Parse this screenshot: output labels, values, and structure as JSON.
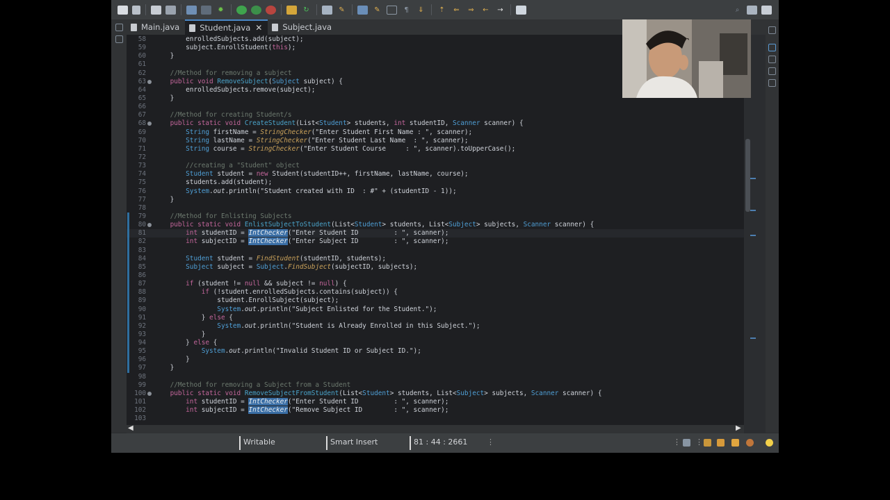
{
  "tabs": [
    {
      "label": "Main.java",
      "active": false
    },
    {
      "label": "Student.java",
      "active": true,
      "close": "✕"
    },
    {
      "label": "Subject.java",
      "active": false
    }
  ],
  "status": {
    "writable": "Writable",
    "insert_mode": "Smart Insert",
    "position": "81 : 44 : 2661"
  },
  "scroll_arrows": {
    "left": "◀",
    "right": "▶"
  },
  "code_lines": [
    {
      "n": "58",
      "segs": [
        [
          "p",
          "        enrolledSubjects.add(subject);"
        ]
      ]
    },
    {
      "n": "59",
      "segs": [
        [
          "p",
          "        subject.EnrollStudent("
        ],
        [
          "kw",
          "this"
        ],
        [
          "p",
          ");"
        ]
      ]
    },
    {
      "n": "60",
      "segs": [
        [
          "p",
          "    }"
        ]
      ]
    },
    {
      "n": "61",
      "segs": []
    },
    {
      "n": "62",
      "segs": [
        [
          "cm",
          "    //Method for removing a subject"
        ]
      ]
    },
    {
      "n": "63",
      "ovr": true,
      "segs": [
        [
          "kw",
          "    public void "
        ],
        [
          "fn",
          "RemoveSubject"
        ],
        [
          "p",
          "("
        ],
        [
          "ty",
          "Subject"
        ],
        [
          "p",
          " subject) {"
        ]
      ]
    },
    {
      "n": "64",
      "segs": [
        [
          "p",
          "        enrolledSubjects.remove(subject);"
        ]
      ]
    },
    {
      "n": "65",
      "segs": [
        [
          "p",
          "    }"
        ]
      ]
    },
    {
      "n": "66",
      "segs": []
    },
    {
      "n": "67",
      "segs": [
        [
          "cm",
          "    //Method for creating Student/s"
        ]
      ]
    },
    {
      "n": "68",
      "ovr": true,
      "segs": [
        [
          "kw",
          "    public static void "
        ],
        [
          "fn",
          "CreateStudent"
        ],
        [
          "p",
          "(List<"
        ],
        [
          "ty",
          "Student"
        ],
        [
          "p",
          "> students, "
        ],
        [
          "kw",
          "int"
        ],
        [
          "p",
          " studentID, "
        ],
        [
          "ty",
          "Scanner"
        ],
        [
          "p",
          " scanner) {"
        ]
      ]
    },
    {
      "n": "69",
      "segs": [
        [
          "ty",
          "        String"
        ],
        [
          "p",
          " firstName = "
        ],
        [
          "mth",
          "StringChecker"
        ],
        [
          "p",
          "(\"Enter Student First Name : \", scanner);"
        ]
      ]
    },
    {
      "n": "70",
      "segs": [
        [
          "ty",
          "        String"
        ],
        [
          "p",
          " lastName = "
        ],
        [
          "mth",
          "StringChecker"
        ],
        [
          "p",
          "(\"Enter Student Last Name  : \", scanner);"
        ]
      ]
    },
    {
      "n": "71",
      "segs": [
        [
          "ty",
          "        String"
        ],
        [
          "p",
          " course = "
        ],
        [
          "mth",
          "StringChecker"
        ],
        [
          "p",
          "(\"Enter Student Course     : \", scanner).toUpperCase();"
        ]
      ]
    },
    {
      "n": "72",
      "segs": []
    },
    {
      "n": "73",
      "segs": [
        [
          "cm",
          "        //creating a \"Student\" object"
        ]
      ]
    },
    {
      "n": "74",
      "segs": [
        [
          "ty",
          "        Student"
        ],
        [
          "p",
          " student = "
        ],
        [
          "kw",
          "new "
        ],
        [
          "p",
          "Student(studentID++, firstName, lastName, course);"
        ]
      ]
    },
    {
      "n": "75",
      "segs": [
        [
          "p",
          "        students.add(student);"
        ]
      ]
    },
    {
      "n": "76",
      "segs": [
        [
          "ty",
          "        System"
        ],
        [
          "p",
          "."
        ],
        [
          "it",
          "out"
        ],
        [
          "p",
          ".println(\"Student created with ID  : #\" + (studentID - 1));"
        ]
      ]
    },
    {
      "n": "77",
      "segs": [
        [
          "p",
          "    }"
        ]
      ]
    },
    {
      "n": "78",
      "segs": []
    },
    {
      "n": "79",
      "changed": true,
      "segs": [
        [
          "cm",
          "    //Method for Enlisting Subjects"
        ]
      ]
    },
    {
      "n": "80",
      "changed": true,
      "ovr": true,
      "segs": [
        [
          "kw",
          "    public static void "
        ],
        [
          "fn",
          "EnlistSubjectToStudent"
        ],
        [
          "p",
          "(List<"
        ],
        [
          "ty",
          "Student"
        ],
        [
          "p",
          "> students, List<"
        ],
        [
          "ty",
          "Subject"
        ],
        [
          "p",
          "> subjects, "
        ],
        [
          "ty",
          "Scanner"
        ],
        [
          "p",
          " scanner) {"
        ]
      ]
    },
    {
      "n": "81",
      "changed": true,
      "cur": true,
      "segs": [
        [
          "kw",
          "        int"
        ],
        [
          "p",
          " studentID = "
        ],
        [
          "hl",
          "IntChecker"
        ],
        [
          "p",
          "(\"Enter Student ID         : \", scanner);"
        ]
      ]
    },
    {
      "n": "82",
      "changed": true,
      "segs": [
        [
          "kw",
          "        int"
        ],
        [
          "p",
          " subjectID = "
        ],
        [
          "hl",
          "IntChecker"
        ],
        [
          "p",
          "(\"Enter Subject ID         : \", scanner);"
        ]
      ]
    },
    {
      "n": "83",
      "changed": true,
      "segs": []
    },
    {
      "n": "84",
      "changed": true,
      "segs": [
        [
          "ty",
          "        Student"
        ],
        [
          "p",
          " student = "
        ],
        [
          "mth",
          "FindStudent"
        ],
        [
          "p",
          "(studentID, students);"
        ]
      ]
    },
    {
      "n": "85",
      "changed": true,
      "segs": [
        [
          "ty",
          "        Subject"
        ],
        [
          "p",
          " subject = "
        ],
        [
          "ty",
          "Subject"
        ],
        [
          "p",
          "."
        ],
        [
          "mth",
          "FindSubject"
        ],
        [
          "p",
          "(subjectID, subjects);"
        ]
      ]
    },
    {
      "n": "86",
      "changed": true,
      "segs": []
    },
    {
      "n": "87",
      "changed": true,
      "segs": [
        [
          "kw",
          "        if"
        ],
        [
          "p",
          " (student != "
        ],
        [
          "kw",
          "null"
        ],
        [
          "p",
          " && subject != "
        ],
        [
          "kw",
          "null"
        ],
        [
          "p",
          ") {"
        ]
      ]
    },
    {
      "n": "88",
      "changed": true,
      "segs": [
        [
          "kw",
          "            if"
        ],
        [
          "p",
          " (!student.enrolledSubjects.contains(subject)) {"
        ]
      ]
    },
    {
      "n": "89",
      "changed": true,
      "segs": [
        [
          "p",
          "                student.EnrollSubject(subject);"
        ]
      ]
    },
    {
      "n": "90",
      "changed": true,
      "segs": [
        [
          "ty",
          "                System"
        ],
        [
          "p",
          "."
        ],
        [
          "it",
          "out"
        ],
        [
          "p",
          ".println(\"Subject Enlisted for the Student.\");"
        ]
      ]
    },
    {
      "n": "91",
      "changed": true,
      "segs": [
        [
          "p",
          "            } "
        ],
        [
          "kw",
          "else"
        ],
        [
          "p",
          " {"
        ]
      ]
    },
    {
      "n": "92",
      "changed": true,
      "segs": [
        [
          "ty",
          "                System"
        ],
        [
          "p",
          "."
        ],
        [
          "it",
          "out"
        ],
        [
          "p",
          ".println(\"Student is Already Enrolled in this Subject.\");"
        ]
      ]
    },
    {
      "n": "93",
      "changed": true,
      "segs": [
        [
          "p",
          "            }"
        ]
      ]
    },
    {
      "n": "94",
      "changed": true,
      "segs": [
        [
          "p",
          "        } "
        ],
        [
          "kw",
          "else"
        ],
        [
          "p",
          " {"
        ]
      ]
    },
    {
      "n": "95",
      "changed": true,
      "segs": [
        [
          "ty",
          "            System"
        ],
        [
          "p",
          "."
        ],
        [
          "it",
          "out"
        ],
        [
          "p",
          ".println(\"Invalid Student ID or Subject ID.\");"
        ]
      ]
    },
    {
      "n": "96",
      "changed": true,
      "segs": [
        [
          "p",
          "        }"
        ]
      ]
    },
    {
      "n": "97",
      "changed": true,
      "segs": [
        [
          "p",
          "    }"
        ]
      ]
    },
    {
      "n": "98",
      "segs": []
    },
    {
      "n": "99",
      "segs": [
        [
          "cm",
          "    //Method for removing a Subject from a Student"
        ]
      ]
    },
    {
      "n": "100",
      "ovr": true,
      "segs": [
        [
          "kw",
          "    public static void "
        ],
        [
          "fn",
          "RemoveSubjectFromStudent"
        ],
        [
          "p",
          "(List<"
        ],
        [
          "ty",
          "Student"
        ],
        [
          "p",
          "> students, List<"
        ],
        [
          "ty",
          "Subject"
        ],
        [
          "p",
          "> subjects, "
        ],
        [
          "ty",
          "Scanner"
        ],
        [
          "p",
          " scanner) {"
        ]
      ]
    },
    {
      "n": "101",
      "segs": [
        [
          "kw",
          "        int"
        ],
        [
          "p",
          " studentID = "
        ],
        [
          "hl",
          "IntChecker"
        ],
        [
          "p",
          "(\"Enter Student ID         : \", scanner);"
        ]
      ]
    },
    {
      "n": "102",
      "segs": [
        [
          "kw",
          "        int"
        ],
        [
          "p",
          " subjectID = "
        ],
        [
          "hl",
          "IntChecker"
        ],
        [
          "p",
          "(\"Remove Subject ID        : \", scanner);"
        ]
      ]
    },
    {
      "n": "103",
      "segs": []
    }
  ]
}
